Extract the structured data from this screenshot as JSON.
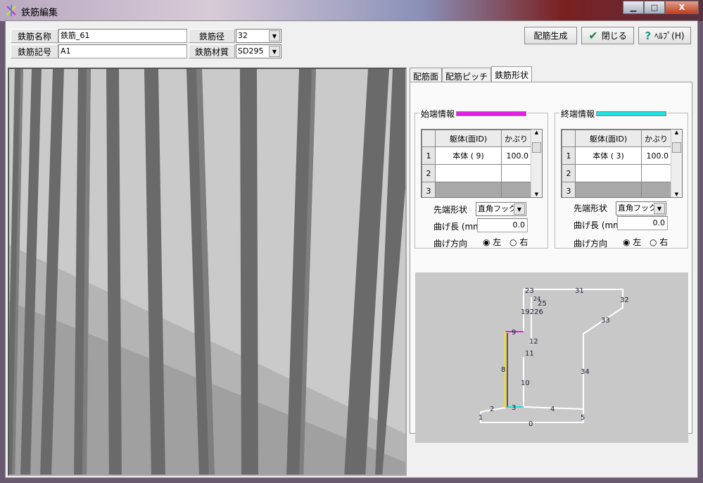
{
  "window": {
    "title": "鉄筋編集",
    "minimize": "▁",
    "maximize": "□",
    "close": "X"
  },
  "form": {
    "name_label": "鉄筋名称",
    "name_value": "鉄筋_61",
    "code_label": "鉄筋記号",
    "code_value": "A1",
    "diameter_label": "鉄筋径",
    "diameter_value": "32",
    "material_label": "鉄筋材質",
    "material_value": "SD295"
  },
  "toolbar": {
    "generate": "配筋生成",
    "close": "閉じる",
    "help": "ﾍﾙﾌﾟ(H)"
  },
  "tabs": [
    "配筋面",
    "配筋ピッチ",
    "鉄筋形状"
  ],
  "start": {
    "title": "始端情報",
    "color": "#e81ce8",
    "col1": "躯体(面ID)",
    "col2": "かぶり",
    "rows": [
      {
        "n": "1",
        "body": "本体 ( 9)",
        "cover": "100.0"
      },
      {
        "n": "2",
        "body": "",
        "cover": ""
      },
      {
        "n": "3",
        "body": "",
        "cover": ""
      }
    ],
    "tip_label": "先端形状",
    "tip_value": "直角フック",
    "bend_len_label": "曲げ長 (mm)",
    "bend_len_value": "0.0",
    "bend_dir_label": "曲げ方向",
    "left": "左",
    "right": "右",
    "dir_selected": "左"
  },
  "end": {
    "title": "終端情報",
    "color": "#20e0e0",
    "col1": "躯体(面ID)",
    "col2": "かぶり",
    "rows": [
      {
        "n": "1",
        "body": "本体 ( 3)",
        "cover": "100.0"
      },
      {
        "n": "2",
        "body": "",
        "cover": ""
      },
      {
        "n": "3",
        "body": "",
        "cover": ""
      }
    ],
    "tip_label": "先端形状",
    "tip_value": "直角フック",
    "bend_len_label": "曲げ長 (mm)",
    "bend_len_value": "0.0",
    "bend_dir_label": "曲げ方向",
    "left": "左",
    "right": "右",
    "dir_selected": "左"
  },
  "diagram_labels": [
    "0",
    "1",
    "2",
    "3",
    "4",
    "5",
    "8",
    "9",
    "10",
    "11",
    "12",
    "19226",
    "23",
    "24",
    "25",
    "31",
    "32",
    "33",
    "34"
  ]
}
